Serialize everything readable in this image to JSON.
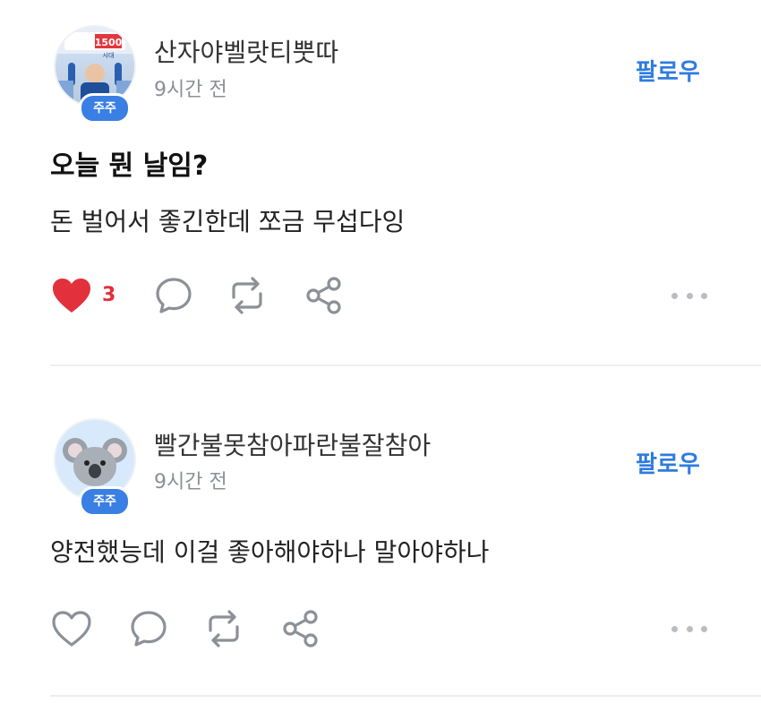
{
  "posts": [
    {
      "username": "산자야벨랏티뿟따",
      "time": "9시간 전",
      "badge": "주주",
      "follow_label": "팔로우",
      "avatar_sign_text": "1500",
      "avatar_sign_sub": "시대",
      "title": "오늘 뭔 날임?",
      "body": "돈 벌어서 좋긴한데 쪼금 무섭다잉",
      "like_count": "3",
      "liked": true
    },
    {
      "username": "빨간불못참아파란불잘참아",
      "time": "9시간 전",
      "badge": "주주",
      "follow_label": "팔로우",
      "body": "양전했능데 이걸 좋아해야하나 말아야하나",
      "liked": false
    }
  ],
  "colors": {
    "accent": "#2f7be0",
    "like": "#e0303c",
    "badge": "#3a7fe3"
  },
  "icons": [
    "heart-icon",
    "comment-icon",
    "repost-icon",
    "share-icon",
    "more-icon"
  ]
}
